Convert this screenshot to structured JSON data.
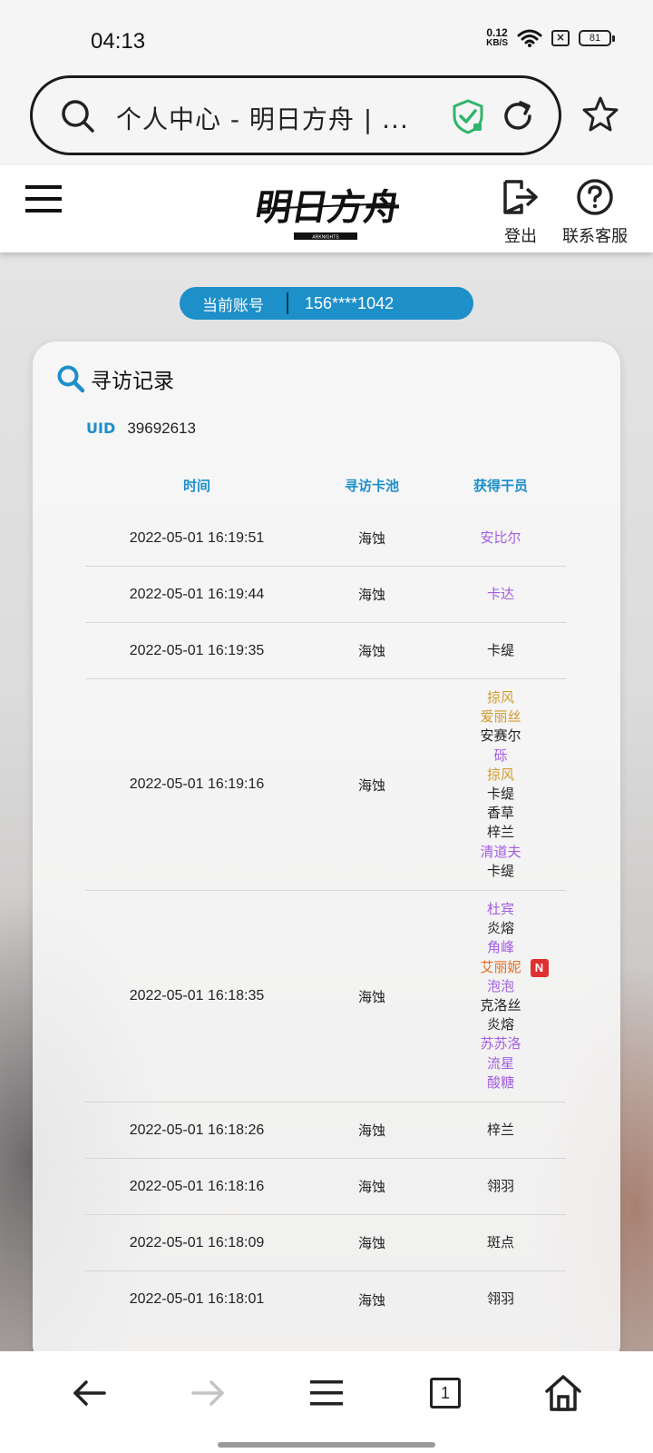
{
  "status_bar": {
    "time": "04:13",
    "net_speed_value": "0.12",
    "net_speed_unit": "KB/S",
    "sim_symbol": "×",
    "battery": "81"
  },
  "browser": {
    "url_title": "个人中心 - 明日方舟 | ..."
  },
  "header": {
    "logo_text": "明日方舟",
    "logo_subtitle": "ARKNIGHTS",
    "logout_label": "登出",
    "help_label": "联系客服"
  },
  "account": {
    "label": "当前账号",
    "value": "156****1042"
  },
  "record": {
    "title": "寻访记录",
    "uid_label": "UID",
    "uid_value": "39692613",
    "columns": [
      "时间",
      "寻访卡池",
      "获得干员"
    ],
    "rows": [
      {
        "time": "2022-05-01 16:19:51",
        "pool": "海蚀",
        "operators": [
          {
            "name": "安比尔",
            "rarity": "r4"
          }
        ]
      },
      {
        "time": "2022-05-01 16:19:44",
        "pool": "海蚀",
        "operators": [
          {
            "name": "卡达",
            "rarity": "r4"
          }
        ]
      },
      {
        "time": "2022-05-01 16:19:35",
        "pool": "海蚀",
        "operators": [
          {
            "name": "卡缇",
            "rarity": "r3"
          }
        ]
      },
      {
        "time": "2022-05-01 16:19:16",
        "pool": "海蚀",
        "operators": [
          {
            "name": "掠风",
            "rarity": "r5"
          },
          {
            "name": "爱丽丝",
            "rarity": "r5"
          },
          {
            "name": "安赛尔",
            "rarity": "r3"
          },
          {
            "name": "砾",
            "rarity": "r4"
          },
          {
            "name": "掠风",
            "rarity": "r5"
          },
          {
            "name": "卡缇",
            "rarity": "r3"
          },
          {
            "name": "香草",
            "rarity": "r3"
          },
          {
            "name": "梓兰",
            "rarity": "r3"
          },
          {
            "name": "清道夫",
            "rarity": "r4"
          },
          {
            "name": "卡缇",
            "rarity": "r3"
          }
        ]
      },
      {
        "time": "2022-05-01 16:18:35",
        "pool": "海蚀",
        "operators": [
          {
            "name": "杜宾",
            "rarity": "r4"
          },
          {
            "name": "炎熔",
            "rarity": "r3"
          },
          {
            "name": "角峰",
            "rarity": "r4"
          },
          {
            "name": "艾丽妮",
            "rarity": "r6new",
            "badge": "N"
          },
          {
            "name": "泡泡",
            "rarity": "r4"
          },
          {
            "name": "克洛丝",
            "rarity": "r3"
          },
          {
            "name": "炎熔",
            "rarity": "r3"
          },
          {
            "name": "苏苏洛",
            "rarity": "r4"
          },
          {
            "name": "流星",
            "rarity": "r4"
          },
          {
            "name": "酸糖",
            "rarity": "r4"
          }
        ]
      },
      {
        "time": "2022-05-01 16:18:26",
        "pool": "海蚀",
        "operators": [
          {
            "name": "梓兰",
            "rarity": "r3"
          }
        ]
      },
      {
        "time": "2022-05-01 16:18:16",
        "pool": "海蚀",
        "operators": [
          {
            "name": "翎羽",
            "rarity": "r3"
          }
        ]
      },
      {
        "time": "2022-05-01 16:18:09",
        "pool": "海蚀",
        "operators": [
          {
            "name": "斑点",
            "rarity": "r3"
          }
        ]
      },
      {
        "time": "2022-05-01 16:18:01",
        "pool": "海蚀",
        "operators": [
          {
            "name": "翎羽",
            "rarity": "r3"
          }
        ]
      }
    ]
  },
  "bottom_nav": {
    "tab_count": "1",
    "icons": [
      "back-arrow-icon",
      "forward-arrow-icon",
      "menu-icon",
      "tabs-icon",
      "home-icon"
    ]
  },
  "colors": {
    "accent": "#1d8fc9",
    "rarity_6_new": "#e86b1e",
    "rarity_5": "#d19a2a",
    "rarity_4": "#a35ee0",
    "rarity_3": "#222222",
    "new_badge": "#e03030"
  }
}
